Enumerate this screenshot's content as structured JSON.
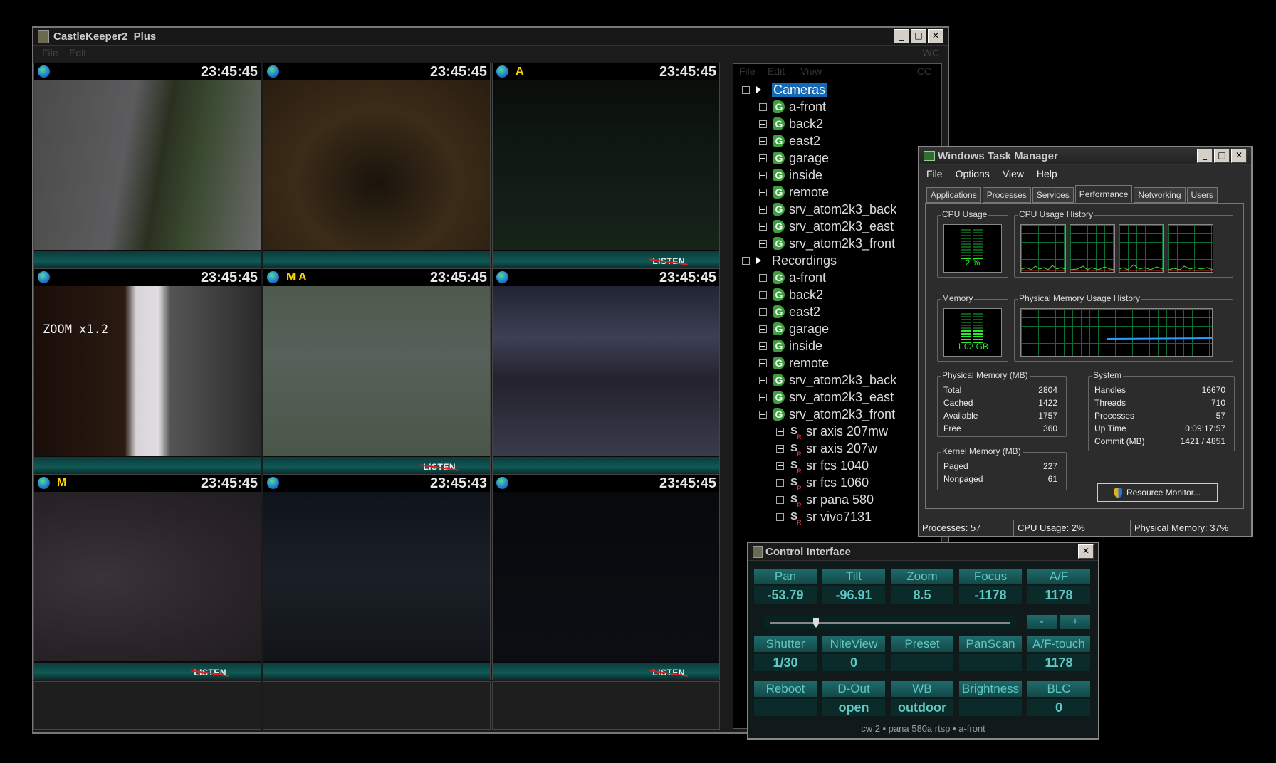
{
  "main_window": {
    "title": "CastleKeeper2_Plus",
    "menu": {
      "file": "File",
      "edit": "Edit",
      "wc": "WC"
    },
    "cameras": [
      {
        "label": "",
        "time": "23:45:45",
        "osd": "",
        "listen": ""
      },
      {
        "label": "",
        "time": "23:45:45",
        "osd": "",
        "listen": ""
      },
      {
        "label": "A",
        "time": "23:45:45",
        "osd": "",
        "listen": "LISTEN"
      },
      {
        "label": "",
        "time": "23:45:45",
        "osd": "",
        "listen": "",
        "zoom": "ZOOM x1.2"
      },
      {
        "label": "M A",
        "time": "23:45:45",
        "osd": "",
        "listen": "LISTEN"
      },
      {
        "label": "",
        "time": "23:45:45",
        "osd": "",
        "listen": ""
      },
      {
        "label": "M",
        "time": "23:45:45",
        "osd": "",
        "listen": "LISTEN"
      },
      {
        "label": "",
        "time": "23:45:43",
        "osd": "",
        "listen": ""
      },
      {
        "label": "",
        "time": "23:45:45",
        "osd": "",
        "listen": "LISTEN"
      }
    ]
  },
  "tree": {
    "menu": {
      "file": "File",
      "edit": "Edit",
      "view": "View",
      "cc": "CC"
    },
    "cameras_label": "Cameras",
    "cameras": [
      "a-front",
      "back2",
      "east2",
      "garage",
      "inside",
      "remote",
      "srv_atom2k3_back",
      "srv_atom2k3_east",
      "srv_atom2k3_front"
    ],
    "recordings_label": "Recordings",
    "recordings": [
      "a-front",
      "back2",
      "east2",
      "garage",
      "inside",
      "remote",
      "srv_atom2k3_back",
      "srv_atom2k3_east",
      "srv_atom2k3_front"
    ],
    "streams": [
      "sr axis 207mw",
      "sr axis 207w",
      "sr fcs 1040",
      "sr fcs 1060",
      "sr pana 580",
      "sr vivo7131"
    ]
  },
  "task_manager": {
    "title": "Windows Task Manager",
    "menu": [
      "File",
      "Options",
      "View",
      "Help"
    ],
    "tabs": [
      "Applications",
      "Processes",
      "Services",
      "Performance",
      "Networking",
      "Users"
    ],
    "active_tab": "Performance",
    "cpu_usage_label": "CPU Usage",
    "cpu_usage_value": "2 %",
    "cpu_history_label": "CPU Usage History",
    "memory_label": "Memory",
    "memory_value": "1.02 GB",
    "mem_history_label": "Physical Memory Usage History",
    "physical_memory": {
      "label": "Physical Memory (MB)",
      "rows": [
        {
          "k": "Total",
          "v": "2804"
        },
        {
          "k": "Cached",
          "v": "1422"
        },
        {
          "k": "Available",
          "v": "1757"
        },
        {
          "k": "Free",
          "v": "360"
        }
      ]
    },
    "system": {
      "label": "System",
      "rows": [
        {
          "k": "Handles",
          "v": "16670"
        },
        {
          "k": "Threads",
          "v": "710"
        },
        {
          "k": "Processes",
          "v": "57"
        },
        {
          "k": "Up Time",
          "v": "0:09:17:57"
        },
        {
          "k": "Commit (MB)",
          "v": "1421 / 4851"
        }
      ]
    },
    "kernel_memory": {
      "label": "Kernel Memory (MB)",
      "rows": [
        {
          "k": "Paged",
          "v": "227"
        },
        {
          "k": "Nonpaged",
          "v": "61"
        }
      ]
    },
    "resource_monitor": "Resource Monitor...",
    "status": {
      "processes": "Processes: 57",
      "cpu": "CPU Usage: 2%",
      "memory": "Physical Memory: 37%"
    }
  },
  "control": {
    "title": "Control Interface",
    "row1_labels": [
      "Pan",
      "Tilt",
      "Zoom",
      "Focus",
      "A/F"
    ],
    "row1_values": [
      "-53.79",
      "-96.91",
      "8.5",
      "-1178",
      "1178"
    ],
    "minus": "-",
    "plus": "+",
    "row2_labels": [
      "Shutter",
      "NiteView",
      "Preset",
      "PanScan",
      "A/F-touch"
    ],
    "row2_values": [
      "1/30",
      "0",
      "",
      "",
      "1178"
    ],
    "row3_labels": [
      "Reboot",
      "D-Out",
      "WB",
      "Brightness",
      "BLC"
    ],
    "row3_values": [
      "",
      "open",
      "outdoor",
      "",
      "0"
    ],
    "status": "cw 2 • pana 580a rtsp • a-front"
  },
  "colors": {
    "tree_selection": "#1669b4",
    "control_accent": "#5fc8c2",
    "camera_label": "#ffd500"
  }
}
